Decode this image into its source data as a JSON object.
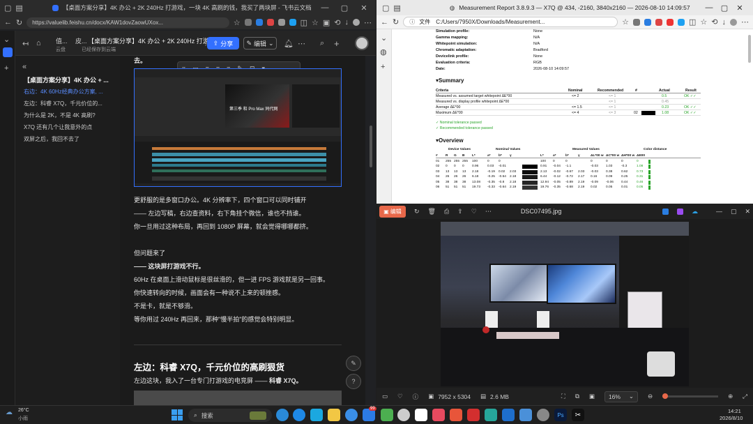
{
  "left": {
    "tab_title": "【桌面方案分享】4K 办公 + 2K 240Hz 打游戏，一块 4K 高刷的钱，我买了两块屏 - 飞书云文档",
    "url": "https://valuelib.feishu.cn/docx/KAW1dovZaowUXox...",
    "breadcrumb_1": "值...",
    "breadcrumb_2": "皮...",
    "doc_title": "【桌面方案分享】4K 办公 + 2K 240Hz 打游...",
    "cloud_label": "云盘",
    "saved_label": "已经保存到云端",
    "share_label": "分享",
    "edit_label": "编辑",
    "outline": [
      "【桌面方案分享】4K 办公 + ...",
      "右边：4K 60Hz经典办公方案, ...",
      "左边：科睿 X7Q，千元价位的...",
      "为什么是 2K，不是 4K 高刷?",
      "X7Q 还有几个让我意外的点",
      "双屏之后，我回不去了"
    ],
    "top_text": "去。",
    "paragraphs": [
      "更舒服的是多窗口办公。4K 分辨率下，四个窗口可以同时铺开",
      "—— 左边写稿，右边查资料，右下角挂个微信，谁也不挡谁。",
      "你一旦用过这种布局，再回到 1080P 屏幕，就会觉得哪哪都挤。",
      "但问题来了",
      "—— 这块屏打游戏不行。",
      "60Hz 在桌面上滑动鼠标是很丝滑的，但一进 FPS 游戏就是另一回事。",
      "你快速转向的时候，画面会有一种说不上来的顿挫感。",
      "不是卡，就是不够滑。",
      "等你用过 240Hz 再回来，那种\"慢半拍\"的感觉会特别明显。"
    ],
    "h2": "左边：科睿 X7Q，千元价位的高刷狠货",
    "h2_sub_a": "左边这块，我入了一台专门打游戏的电竞屏 —— ",
    "h2_sub_b": "科睿 X7Q。",
    "video_overlay": "第三季 和 Pro Max 同代网"
  },
  "report": {
    "tab_title": "Measurement Report 3.8.9.3 — X7Q @ 434, -2160, 3840x2160 — 2026-08-10 14:09:57",
    "file_label": "文件",
    "url": "C:/Users/7950X/Downloads/Measurement...",
    "info": [
      {
        "k": "Simulation profile:",
        "v": "None"
      },
      {
        "k": "Gamma mapping:",
        "v": "N/A"
      },
      {
        "k": "Whitepoint simulation:",
        "v": "N/A"
      },
      {
        "k": "Chromatic adaptation:",
        "v": "Bradford"
      },
      {
        "k": "Devicelink profile:",
        "v": "None"
      },
      {
        "k": "Evaluation criteria:",
        "v": "RGB"
      },
      {
        "k": "Date:",
        "v": "2026-08-10 14:09:57"
      }
    ],
    "summary_title": "▾Summary",
    "summary_headers": [
      "Criteria",
      "Nominal",
      "Recommended",
      "#",
      "Actual",
      "Result"
    ],
    "summary_rows": [
      {
        "c": "Measured vs. assumed target whitepoint ΔE*00",
        "n": "<= 2",
        "r": "<= 1",
        "h": "",
        "a": "0.5",
        "res": "OK ✓✓"
      },
      {
        "c": "Measured vs. display profile whitepoint ΔE*00",
        "n": "",
        "r": "<= 1",
        "h": "",
        "a": "0.45",
        "res": ""
      },
      {
        "c": "Average ΔE*00",
        "n": "<= 1.5",
        "r": "<= 1",
        "h": "",
        "a": "0.23",
        "res": "OK ✓✓"
      },
      {
        "c": "Maximum ΔE*00",
        "n": "<= 4",
        "r": "<= 3",
        "h": "02",
        "a": "1.08",
        "res": "OK ✓✓"
      }
    ],
    "passed_1": "✓ Nominal tolerance passed",
    "passed_2": "✓ Recommended tolerance passed",
    "overview_title": "▾Overview",
    "ov_groups": [
      "Device Values",
      "Nominal Values",
      "Measured Values",
      "Color distance"
    ],
    "ov_headers": [
      "#",
      "R",
      "G",
      "B",
      "L*",
      "a*",
      "b*",
      "γ",
      "L*",
      "a*",
      "b*",
      "γ",
      "ΔL*00 w",
      "ΔC*00 w",
      "ΔH*00 w",
      "ΔE00"
    ],
    "ov_rows": [
      [
        "01",
        "255",
        "255",
        "255",
        "100",
        "0",
        "0",
        "",
        "100",
        "0",
        "0",
        "",
        "0",
        "0",
        "0",
        "0"
      ],
      [
        "02",
        "0",
        "0",
        "0",
        "0.96",
        "0.03",
        "-0.01",
        "",
        "0.91",
        "-0.04",
        "-1.1",
        "",
        "-0.03",
        "1.03",
        "-0.3",
        "1.08"
      ],
      [
        "03",
        "13",
        "13",
        "13",
        "2.18",
        "-0.19",
        "0.02",
        "2.03",
        "2.13",
        "-0.02",
        "-0.67",
        "2.03",
        "-0.03",
        "0.38",
        "0.62",
        "0.73"
      ],
      [
        "04",
        "26",
        "26",
        "26",
        "6.18",
        "-0.25",
        "-0.54",
        "2.18",
        "6.44",
        "-0.12",
        "-0.72",
        "2.17",
        "0.16",
        "0.09",
        "0.25",
        "0.31"
      ],
      [
        "05",
        "38",
        "38",
        "38",
        "13.08",
        "-0.35",
        "-0.8",
        "2.18",
        "12.94",
        "-0.05",
        "-0.89",
        "2.19",
        "-0.09",
        "-0.06",
        "0.44",
        "0.46"
      ],
      [
        "06",
        "51",
        "51",
        "51",
        "19.73",
        "-0.33",
        "-0.64",
        "2.19",
        "19.76",
        "-0.35",
        "-0.68",
        "2.19",
        "0.02",
        "0.05",
        "0.01",
        "0.05"
      ]
    ]
  },
  "photos": {
    "edit_label": "编辑",
    "filename": "DSC07495.jpg",
    "dimensions": "7952 x 5304",
    "filesize": "2.6 MB",
    "zoom": "16%"
  },
  "taskbar": {
    "temp": "26°C",
    "weather": "小雨",
    "search_label": "搜索",
    "time": "14:21",
    "date": "2026/8/10",
    "badge": "99"
  },
  "colors": {
    "accent": "#3370ff",
    "ok": "#2aa52a",
    "photos_edit": "#e8684a"
  }
}
